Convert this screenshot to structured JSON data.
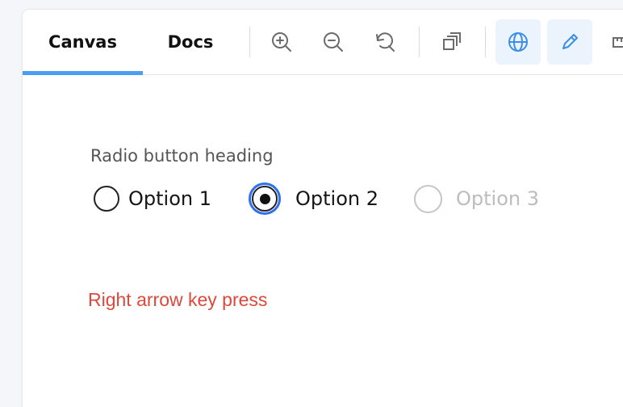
{
  "tabs": [
    {
      "label": "Canvas",
      "active": true
    },
    {
      "label": "Docs",
      "active": false
    }
  ],
  "toolbar": {
    "buttons": [
      {
        "icon": "zoom-in-icon"
      },
      {
        "icon": "zoom-out-icon"
      },
      {
        "icon": "reset-zoom-icon"
      },
      {
        "icon": "layers-icon"
      },
      {
        "icon": "globe-icon",
        "active": true
      },
      {
        "icon": "pencil-icon",
        "active": true
      },
      {
        "icon": "ruler-icon"
      }
    ],
    "accent_color": "#4a9df0"
  },
  "radio_group": {
    "heading": "Radio button heading",
    "options": [
      {
        "label": "Option 1",
        "checked": false,
        "disabled": false
      },
      {
        "label": "Option 2",
        "checked": true,
        "disabled": false,
        "focused": true
      },
      {
        "label": "Option 3",
        "checked": false,
        "disabled": true
      }
    ],
    "focus_color": "#2f6ff0"
  },
  "annotation": {
    "text": "Right arrow key press",
    "color": "#e0483b"
  }
}
